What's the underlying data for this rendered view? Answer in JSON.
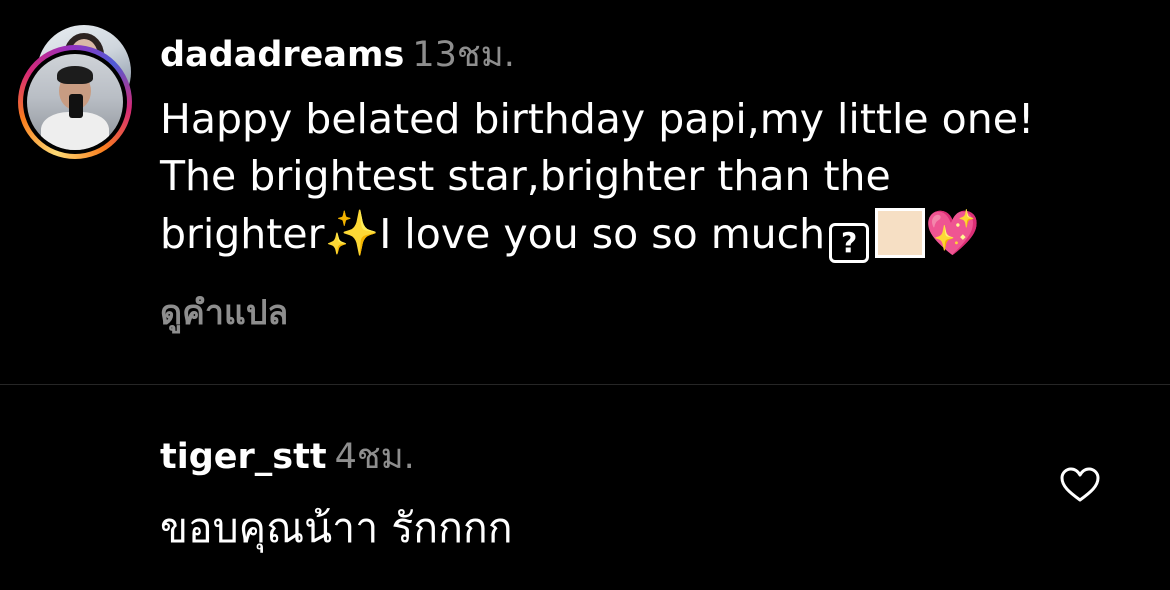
{
  "comments": [
    {
      "username": "dadadreams",
      "time": "13ชม.",
      "text_line1": "Happy belated birthday papi,my little one!",
      "text_line2": "The brightest star,brighter than the",
      "text_line3_prefix": "brighter",
      "text_line3_sparkles": "✨",
      "text_line3_main": "I love you so so much",
      "text_line3_unknown": "?",
      "text_line3_heart": "💖",
      "translate_label": "ดูคำแปล"
    },
    {
      "username": "tiger_stt",
      "time": "4ชม.",
      "text": "ขอบคุณน้าา รักกกก",
      "like_icon": "heart-icon"
    }
  ],
  "colors": {
    "background": "#000000",
    "text_primary": "#ffffff",
    "text_secondary": "#8e8e8e",
    "divider": "#262626",
    "skin_tone_swatch": "#f6dfc4"
  }
}
